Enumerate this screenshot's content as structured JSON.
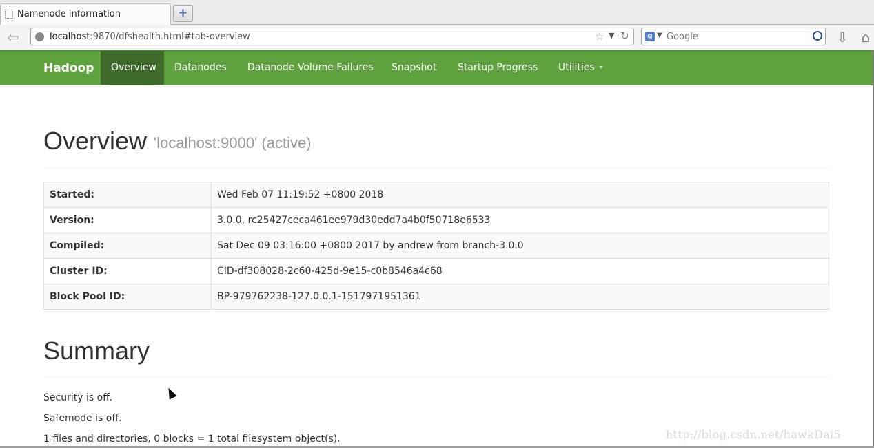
{
  "browser": {
    "tab_title": "Namenode information",
    "new_tab_icon": "plus-icon",
    "url_host": "localhost",
    "url_rest": ":9870/dfshealth.html#tab-overview",
    "search_placeholder": "Google",
    "search_engine_glyph": "g"
  },
  "nav": {
    "brand": "Hadoop",
    "items": [
      {
        "label": "Overview",
        "active": true
      },
      {
        "label": "Datanodes"
      },
      {
        "label": "Datanode Volume Failures"
      },
      {
        "label": "Snapshot"
      },
      {
        "label": "Startup Progress"
      },
      {
        "label": "Utilities"
      }
    ]
  },
  "overview": {
    "title": "Overview",
    "subtitle": "'localhost:9000' (active)",
    "rows": [
      {
        "key": "Started:",
        "value": "Wed Feb 07 11:19:52 +0800 2018"
      },
      {
        "key": "Version:",
        "value": "3.0.0, rc25427ceca461ee979d30edd7a4b0f50718e6533"
      },
      {
        "key": "Compiled:",
        "value": "Sat Dec 09 03:16:00 +0800 2017 by andrew from branch-3.0.0"
      },
      {
        "key": "Cluster ID:",
        "value": "CID-df308028-2c60-425d-9e15-c0b8546a4c68"
      },
      {
        "key": "Block Pool ID:",
        "value": "BP-979762238-127.0.0.1-1517971951361"
      }
    ]
  },
  "summary": {
    "title": "Summary",
    "lines": [
      "Security is off.",
      "Safemode is off.",
      "1 files and directories, 0 blocks = 1 total filesystem object(s)."
    ]
  },
  "watermark": "http://blog.csdn.net/hawkDai5"
}
